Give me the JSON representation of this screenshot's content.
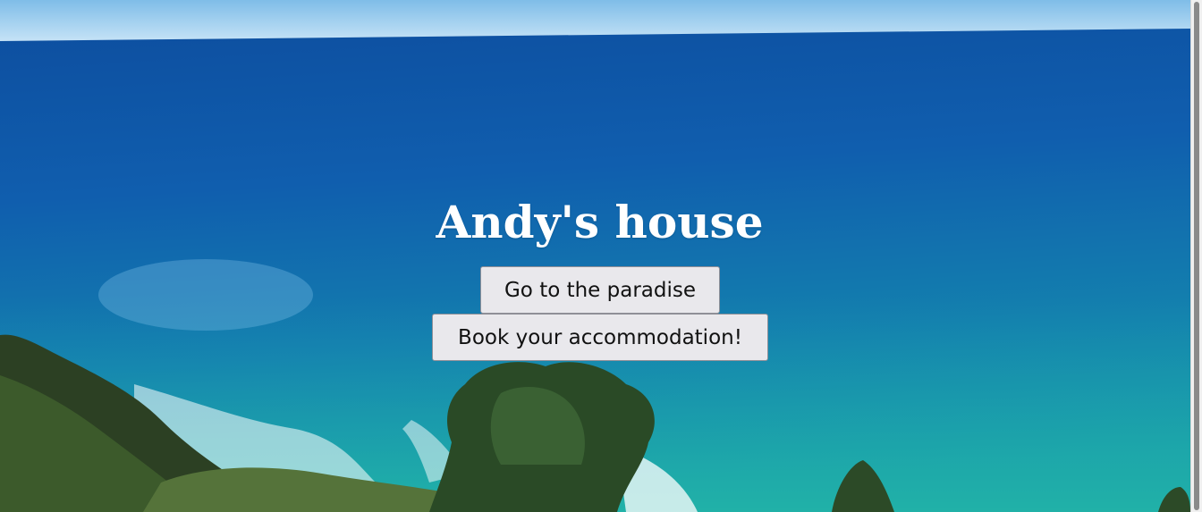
{
  "page": {
    "title": "Andy's house"
  },
  "buttons": {
    "paradise_label": "Go to the paradise",
    "book_label": "Book your accommodation!"
  },
  "colors": {
    "title_text": "#ffffff",
    "button_bg": "#e9e8ec",
    "button_border": "#8f8f97",
    "sky": "#a9d4f2",
    "ocean_deep": "#0b4f9c",
    "ocean_turquoise": "#1aa6a8",
    "foliage": "#2f4a22"
  },
  "background": {
    "icon": "ocean-coastline-photo"
  }
}
